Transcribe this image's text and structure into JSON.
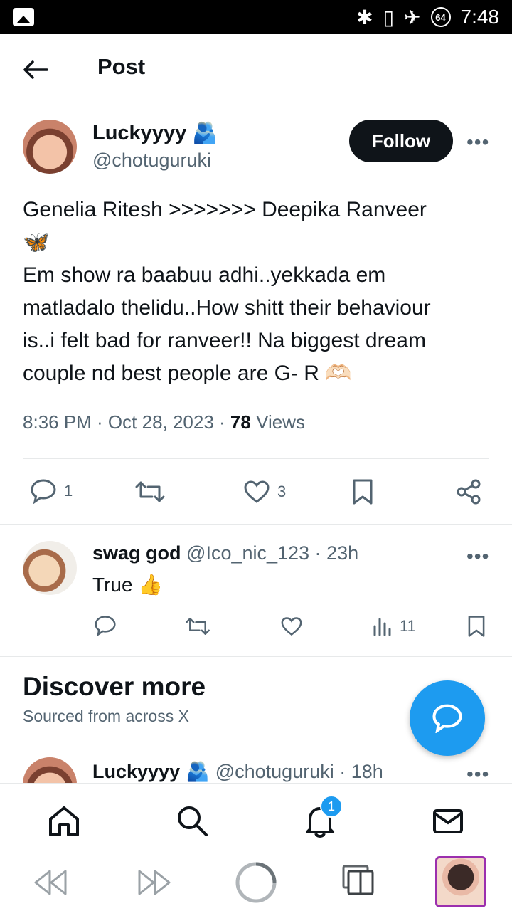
{
  "status_bar": {
    "time": "7:48",
    "battery": "64"
  },
  "header": {
    "title": "Post"
  },
  "post": {
    "author_name": "Luckyyyy",
    "author_emoji": "🫂",
    "author_handle": "@chotuguruki",
    "follow_label": "Follow",
    "more": "•••",
    "text": "Genelia Ritesh >>>>>>> Deepika Ranveer\n🦋\nEm show ra baabuu adhi..yekkada em\nmatladalo thelidu..How shitt their behaviour\nis..i felt bad for ranveer!! Na biggest dream\ncouple nd best people are G- R 🫶🏻",
    "time": "8:36 PM · Oct 28, 2023 · ",
    "views_count": "78",
    "views_label": " Views",
    "replies": "1",
    "likes": "3"
  },
  "reply": {
    "name": "swag god",
    "handle_time": "@Ico_nic_123 · 23h",
    "text": "True 👍",
    "views": "11",
    "more": "•••"
  },
  "discover": {
    "title": "Discover more",
    "subtitle": "Sourced from across X"
  },
  "next_post": {
    "name": "Luckyyyy",
    "emoji": "🫂",
    "handle_time": "@chotuguruki · 18h",
    "more": "•••"
  },
  "bottom_nav": {
    "notification_count": "1"
  }
}
